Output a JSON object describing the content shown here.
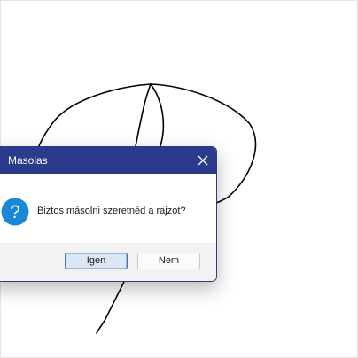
{
  "dialog": {
    "title": "Masolas",
    "message": "Biztos másolni szeretnéd a rajzot?",
    "icon": "question-icon",
    "buttons": {
      "yes_label": "Igen",
      "no_label": "Nem"
    }
  },
  "colors": {
    "titlebar": "#2b3a8a",
    "icon": "#1a87d8",
    "footer": "#f2f2f2"
  }
}
